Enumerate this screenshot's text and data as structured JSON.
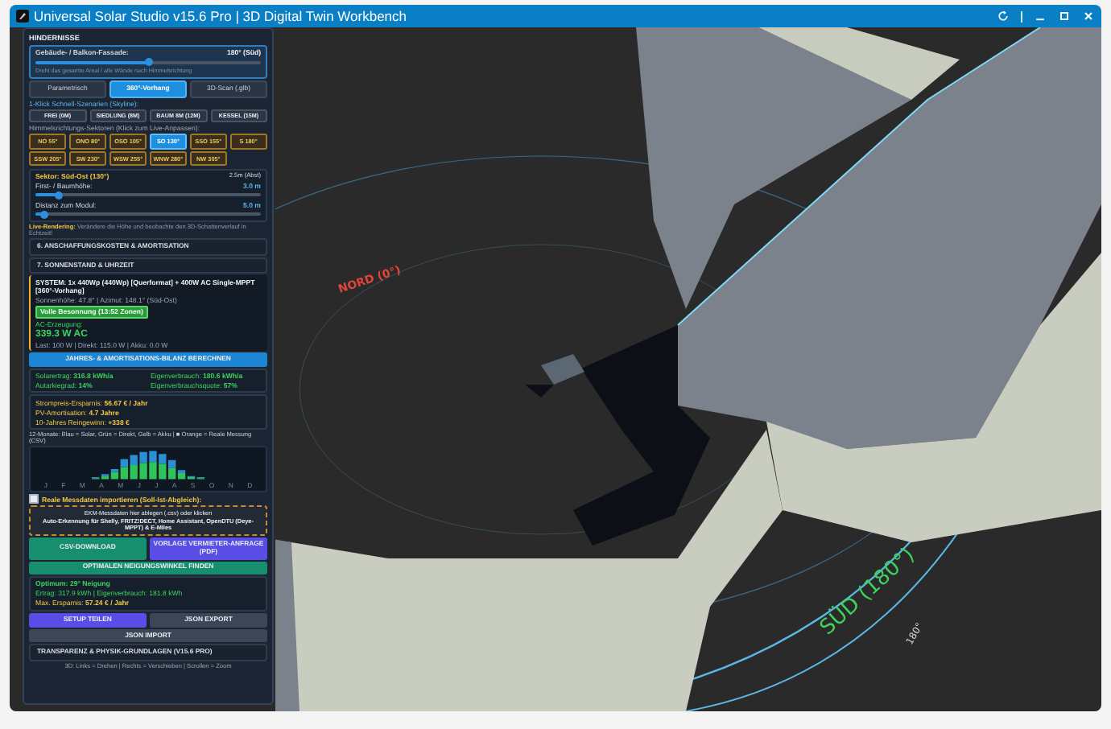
{
  "window": {
    "title": "Universal Solar Studio v15.6 Pro | 3D Digital Twin Workbench"
  },
  "sidebar": {
    "section_title": "HINDERNISSE",
    "facade": {
      "label": "Gebäude- / Balkon-Fassade:",
      "value": "180° (Süd)",
      "level": 0.5,
      "hint": "Dreht das gesamte Areal / alle Wände nach Himmelsrichtung"
    },
    "mode_tabs": [
      {
        "label": "Parametrisch",
        "selected": false
      },
      {
        "label": "360°-Vorhang",
        "selected": true
      },
      {
        "label": "3D-Scan (.glb)",
        "selected": false
      }
    ],
    "scenario_title": "1-Klick Schnell-Szenarien (Skyline):",
    "scenarios": [
      "FREI (0M)",
      "SIEDLUNG (8M)",
      "BAUM 8M (12M)",
      "KESSEL (15M)"
    ],
    "sector_title": "Himmelsrichtungs-Sektoren (Klick zum Live-Anpassen):",
    "sectors": [
      {
        "label": "NO 55°",
        "selected": false
      },
      {
        "label": "ONO 80°",
        "selected": false
      },
      {
        "label": "OSO 105°",
        "selected": false
      },
      {
        "label": "SO 130°",
        "selected": true
      },
      {
        "label": "SSO 155°",
        "selected": false
      },
      {
        "label": "S 180°",
        "selected": false
      },
      {
        "label": "SSW 205°",
        "selected": false
      },
      {
        "label": "SW 230°",
        "selected": false
      },
      {
        "label": "WSW 255°",
        "selected": false
      },
      {
        "label": "WNW 280°",
        "selected": false
      },
      {
        "label": "NW 305°",
        "selected": false
      }
    ],
    "sector_panel": {
      "title": "Sektor: Süd-Ost (130°)",
      "note": "2.5m (Abst)",
      "sliders": [
        {
          "label": "First- / Baumhöhe:",
          "value": "3.0 m",
          "level": 0.1
        },
        {
          "label": "Distanz zum Modul:",
          "value": "5.0 m",
          "level": 0.04
        }
      ]
    },
    "live_note": {
      "bold": "Live-Rendering:",
      "text": "Verändere die Höhe und beobachte den 3D-Schattenverlauf in Echtzeit!"
    },
    "collapsed_sections": [
      "6. ANSCHAFFUNGSKOSTEN & AMORTISATION",
      "7. SONNENSTAND & UHRZEIT"
    ],
    "system": {
      "title": "SYSTEM: 1x 440Wp (440Wp) [Querformat] + 400W AC Single-MPPT [360°-Vorhang]",
      "sun": "Sonnenhöhe: 47.8° | Azimut: 148.1° (Süd-Ost)",
      "badge": "Volle Besonnung (13:52 Zonen)",
      "ac_label": "AC-Erzeugung:",
      "ac_value": "339.3 W AC",
      "flows": "Last: 100 W | Direkt: 115.0 W | Akku: 0.0 W"
    },
    "calc_button": "JAHRES- & AMORTISATIONS-BILANZ BERECHNEN",
    "stats": [
      {
        "label": "Solarertrag:",
        "value": "316.8 kWh/a"
      },
      {
        "label": "Eigenverbrauch:",
        "value": "180.6 kWh/a"
      },
      {
        "label": "Autarkiegrad:",
        "value": "14%"
      },
      {
        "label": "Eigenverbrauchsquote:",
        "value": "57%"
      }
    ],
    "finance": [
      {
        "label": "Strompreis-Ersparnis:",
        "value": "56.67 € / Jahr"
      },
      {
        "label": "PV-Amortisation:",
        "value": "4.7 Jahre"
      },
      {
        "label": "10-Jahres Reingewinn:",
        "value": "+338 €"
      }
    ],
    "chart_caption": "12-Monate: Blau = Solar, Grün = Direkt, Gelb = Akku | ■ Orange = Reale Messung (CSV)",
    "months": [
      "J",
      "F",
      "M",
      "A",
      "M",
      "J",
      "J",
      "A",
      "S",
      "O",
      "N",
      "D"
    ],
    "import": {
      "label": "Reale Messdaten importieren (Soll-Ist-Abgleich):",
      "checked": false,
      "drop_title": "EKM-Messdaten hier ablegen (.csv) oder klicken",
      "drop_text": "Auto-Erkennung für Shelly, FRITZ!DECT, Home Assistant, OpenDTU (Deye-MPPT) & E-Miles"
    },
    "csv_button": "CSV-DOWNLOAD",
    "pdf_button": "VORLAGE VERMIETER-ANFRAGE (PDF)",
    "optimize_button": "OPTIMALEN NEIGUNGSWINKEL FINDEN",
    "optimum": {
      "title": "Optimum: 29° Neigung",
      "yield": "Ertrag: 317.9 kWh | Eigenverbrauch: 181.8 kWh",
      "saving_label": "Max. Ersparnis:",
      "saving_value": "57.24 € / Jahr"
    },
    "share_button": "SETUP TEILEN",
    "export_button": "JSON EXPORT",
    "import_button": "JSON IMPORT",
    "transparency_section": "TRANSPARENZ & PHYSIK-GRUNDLAGEN (V15.6 PRO)",
    "help": "3D: Links = Drehen | Rechts = Verschieben | Scrollen = Zoom"
  },
  "scene": {
    "north_label": "NORD (0°)",
    "south_label": "SÜD (180°)",
    "south_tick": "180°"
  }
}
